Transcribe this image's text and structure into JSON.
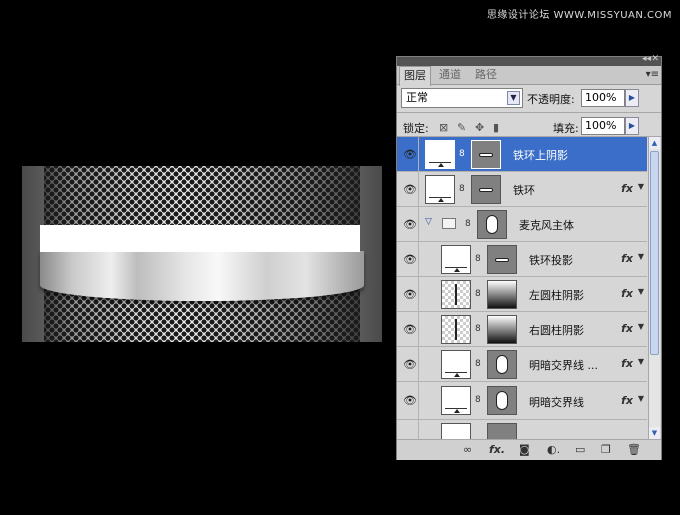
{
  "watermark": "思缘设计论坛 WWW.MISSYUAN.COM",
  "panel": {
    "tabs": [
      "图层",
      "通道",
      "路径"
    ],
    "blend_mode": "正常",
    "opacity_label": "不透明度:",
    "opacity_value": "100%",
    "lock_label": "锁定:",
    "fill_label": "填充:",
    "fill_value": "100%",
    "layers": [
      {
        "name": "铁环上阴影",
        "selected": true,
        "fx": false
      },
      {
        "name": "铁环",
        "selected": false,
        "fx": true,
        "fx_label": "fx"
      },
      {
        "name": "麦克风主体",
        "group": true
      },
      {
        "name": "铁环投影",
        "fx": true,
        "fx_label": "fx"
      },
      {
        "name": "左圆柱阴影",
        "fx": true,
        "fx_label": "fx"
      },
      {
        "name": "右圆柱阴影",
        "fx": true,
        "fx_label": "fx"
      },
      {
        "name": "明暗交界线 ...",
        "fx": true,
        "fx_label": "fx"
      },
      {
        "name": "明暗交界线",
        "fx": true,
        "fx_label": "fx"
      }
    ]
  },
  "icons": {
    "eye": "eye-icon",
    "link": "chain-link-icon",
    "fx": "fx-icon",
    "mask": "mask-icon",
    "adjust": "adjustment-icon",
    "folder": "folder-icon",
    "new": "new-layer-icon",
    "trash": "trash-icon"
  }
}
